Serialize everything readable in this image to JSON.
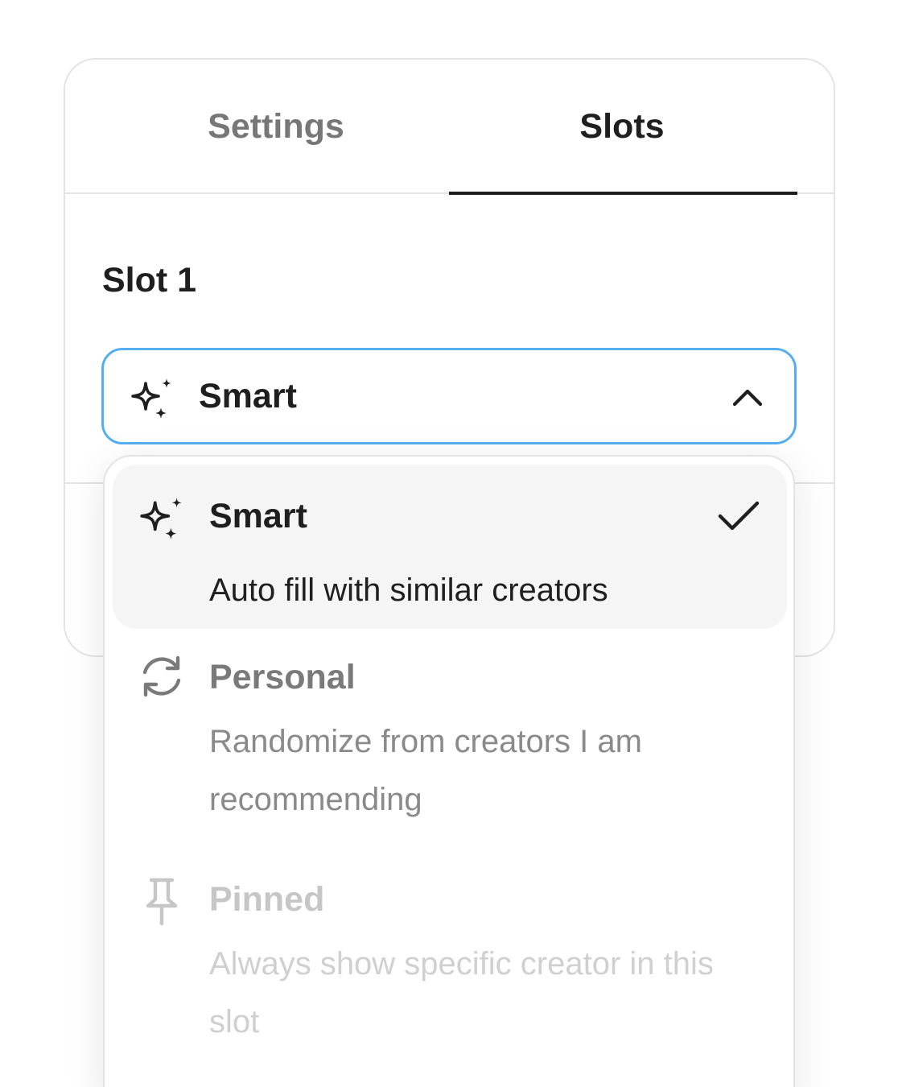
{
  "tabs": {
    "settings_label": "Settings",
    "slots_label": "Slots",
    "active": "Slots"
  },
  "slot": {
    "label": "Slot 1",
    "select": {
      "value": "Smart",
      "icon": "sparkles-icon",
      "expanded": true
    }
  },
  "dropdown": {
    "options": [
      {
        "title": "Smart",
        "description": "Auto fill with similar creators",
        "icon": "sparkles-icon",
        "selected": true
      },
      {
        "title": "Personal",
        "description": "Randomize from creators I am recommending",
        "icon": "refresh-icon",
        "selected": false
      },
      {
        "title": "Pinned",
        "description": "Always show specific creator in this slot",
        "icon": "pin-icon",
        "selected": false
      }
    ]
  },
  "colors": {
    "focus_border": "#56aef0",
    "text_primary": "#1f1f1f",
    "text_muted": "#7a7a7a",
    "text_faded": "#c6c6c6",
    "selected_bg": "#f5f5f5"
  }
}
